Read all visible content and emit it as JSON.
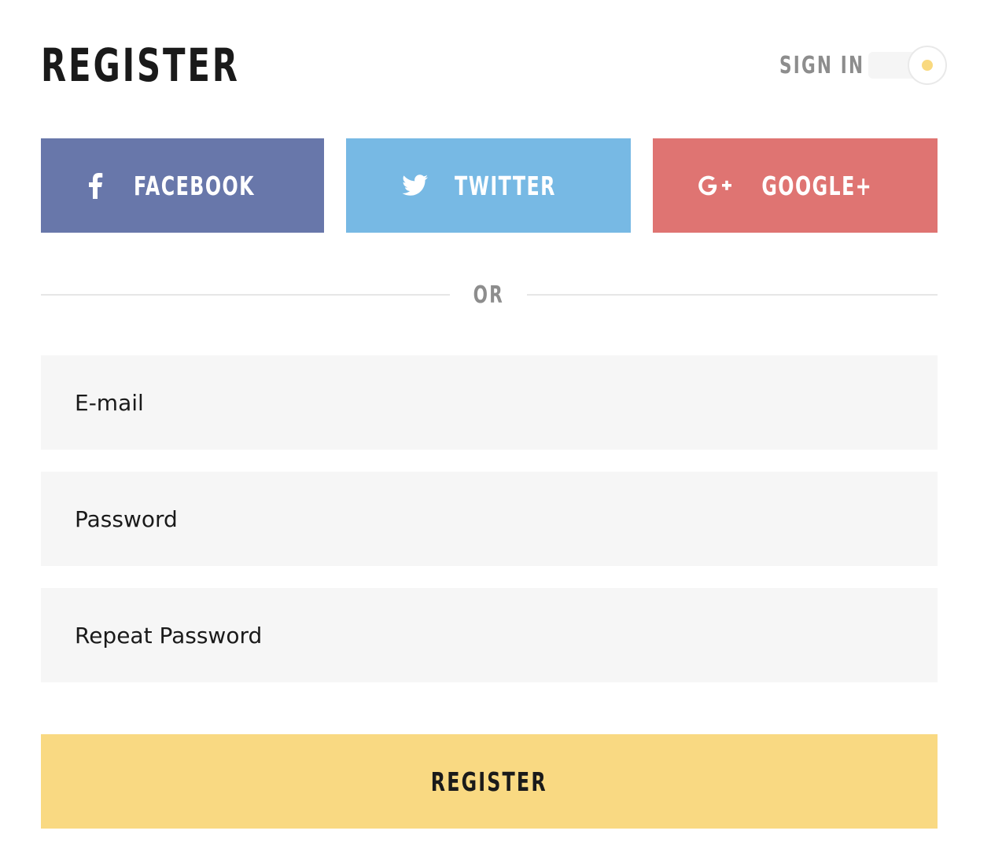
{
  "header": {
    "title": "REGISTER",
    "toggle_label": "SIGN IN"
  },
  "social": {
    "facebook": {
      "label": "FACEBOOK",
      "icon": "facebook-icon",
      "color": "#6877aa"
    },
    "twitter": {
      "label": "TWITTER",
      "icon": "twitter-icon",
      "color": "#77b9e4"
    },
    "google": {
      "label": "GOOGLE+",
      "icon": "google-plus-icon",
      "color": "#df7472"
    }
  },
  "divider": {
    "text": "OR"
  },
  "form": {
    "email": {
      "placeholder": "E-mail",
      "value": ""
    },
    "password": {
      "placeholder": "Password",
      "value": ""
    },
    "repeat_password": {
      "placeholder": "Repeat Password",
      "value": ""
    },
    "submit_label": "REGISTER"
  },
  "colors": {
    "accent": "#f9d982",
    "text_dark": "#1a1a1a",
    "text_muted": "#8d8d8d",
    "field_bg": "#f6f6f6"
  }
}
